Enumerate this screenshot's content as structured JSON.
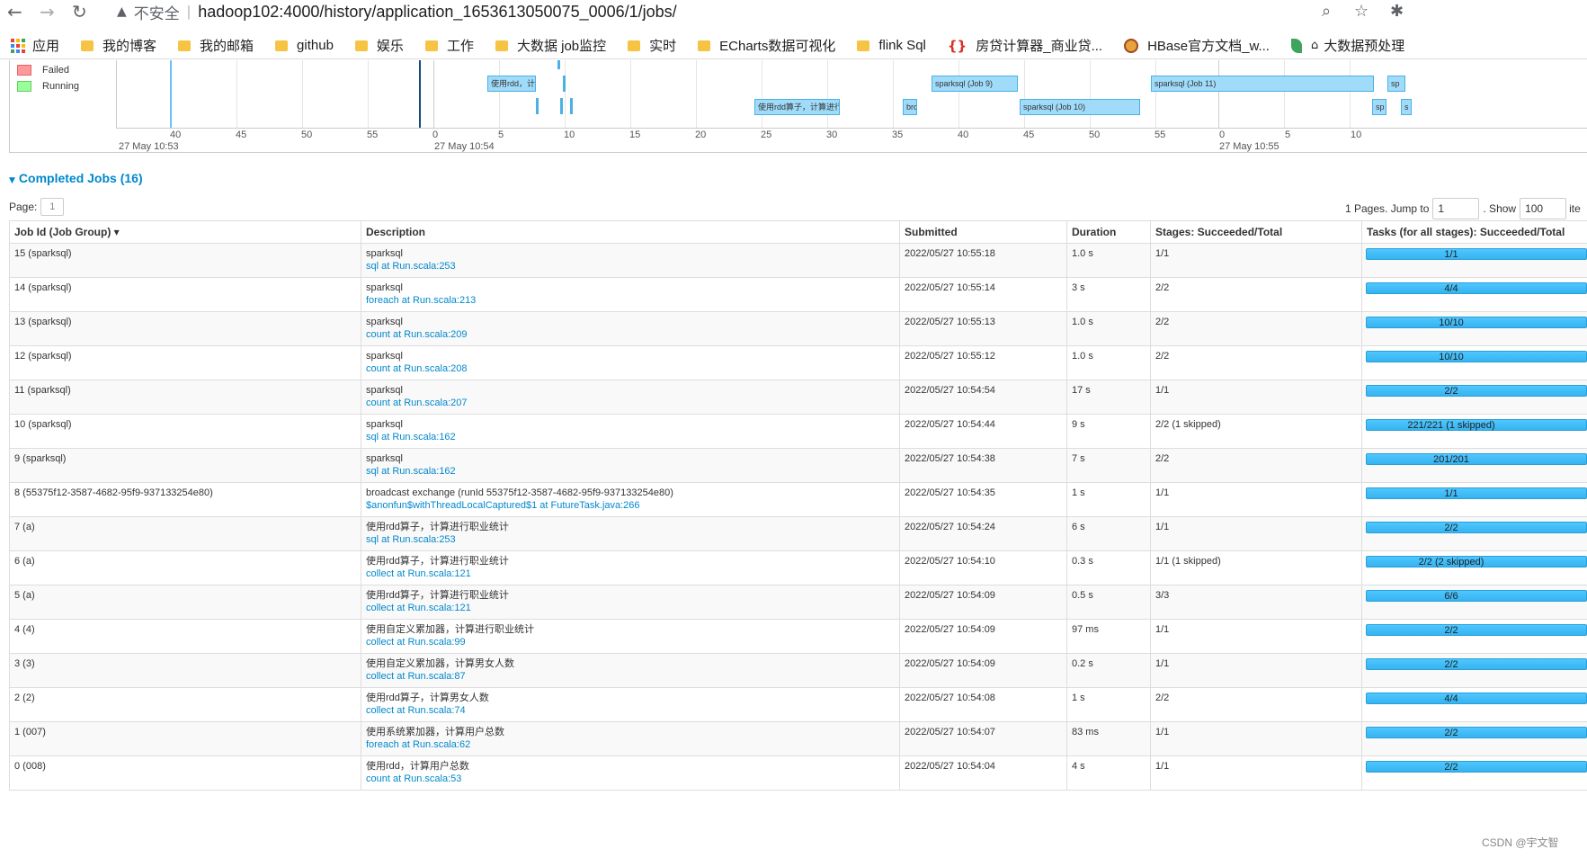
{
  "browser": {
    "insecure_label": "不安全",
    "url": "hadoop102:4000/history/application_1653613050075_0006/1/jobs/",
    "bookmarks": [
      "应用",
      "我的博客",
      "我的邮箱",
      "github",
      "娱乐",
      "工作",
      "大数据 job监控",
      "实时",
      "ECharts数据可视化",
      "flink Sql",
      "房贷计算器_商业贷...",
      "HBase官方文档_w...",
      "大数据预处理"
    ]
  },
  "timeline": {
    "legend": [
      {
        "label": "Failed",
        "color": "#ff9999"
      },
      {
        "label": "Running",
        "color": "#99ff99"
      }
    ],
    "ticks": [
      "40",
      "45",
      "50",
      "55",
      "0",
      "5",
      "10",
      "15",
      "20",
      "25",
      "30",
      "35",
      "40",
      "45",
      "50",
      "55",
      "0",
      "5",
      "10"
    ],
    "date_labels": [
      "27 May 10:53",
      "27 May 10:54",
      "27 May 10:55"
    ],
    "jobs": [
      {
        "label": "使用rdd，计"
      },
      {
        "label": "使用rdd算子，计算进行"
      },
      {
        "label": "sparksql (Job 9)"
      },
      {
        "label": "bro"
      },
      {
        "label": "sparksql (Job 10)"
      },
      {
        "label": "sparksql (Job 11)"
      },
      {
        "label": "sp"
      },
      {
        "label": "sp"
      },
      {
        "label": "s"
      }
    ]
  },
  "completed": {
    "title": "Completed Jobs (16)",
    "page_label": "Page:",
    "page_value": "1",
    "pages_text": "1 Pages. Jump to",
    "jump_value": "1",
    "show_text": ". Show",
    "show_value": "100",
    "items_text": "ite",
    "columns": [
      "Job Id (Job Group) ▾",
      "Description",
      "Submitted",
      "Duration",
      "Stages: Succeeded/Total",
      "Tasks (for all stages): Succeeded/Total"
    ],
    "rows": [
      {
        "id": "15 (sparksql)",
        "desc": "sparksql",
        "link": "sql at Run.scala:253",
        "submitted": "2022/05/27 10:55:18",
        "duration": "1.0 s",
        "stages": "1/1",
        "tasks": "1/1"
      },
      {
        "id": "14 (sparksql)",
        "desc": "sparksql",
        "link": "foreach at Run.scala:213",
        "submitted": "2022/05/27 10:55:14",
        "duration": "3 s",
        "stages": "2/2",
        "tasks": "4/4"
      },
      {
        "id": "13 (sparksql)",
        "desc": "sparksql",
        "link": "count at Run.scala:209",
        "submitted": "2022/05/27 10:55:13",
        "duration": "1.0 s",
        "stages": "2/2",
        "tasks": "10/10"
      },
      {
        "id": "12 (sparksql)",
        "desc": "sparksql",
        "link": "count at Run.scala:208",
        "submitted": "2022/05/27 10:55:12",
        "duration": "1.0 s",
        "stages": "2/2",
        "tasks": "10/10"
      },
      {
        "id": "11 (sparksql)",
        "desc": "sparksql",
        "link": "count at Run.scala:207",
        "submitted": "2022/05/27 10:54:54",
        "duration": "17 s",
        "stages": "1/1",
        "tasks": "2/2"
      },
      {
        "id": "10 (sparksql)",
        "desc": "sparksql",
        "link": "sql at Run.scala:162",
        "submitted": "2022/05/27 10:54:44",
        "duration": "9 s",
        "stages": "2/2 (1 skipped)",
        "tasks": "221/221 (1 skipped)"
      },
      {
        "id": "9 (sparksql)",
        "desc": "sparksql",
        "link": "sql at Run.scala:162",
        "submitted": "2022/05/27 10:54:38",
        "duration": "7 s",
        "stages": "2/2",
        "tasks": "201/201"
      },
      {
        "id": "8 (55375f12-3587-4682-95f9-937133254e80)",
        "desc": "broadcast exchange (runId 55375f12-3587-4682-95f9-937133254e80)",
        "link": "$anonfun$withThreadLocalCaptured$1 at FutureTask.java:266",
        "submitted": "2022/05/27 10:54:35",
        "duration": "1 s",
        "stages": "1/1",
        "tasks": "1/1"
      },
      {
        "id": "7 (a)",
        "desc": "使用rdd算子，计算进行职业统计",
        "link": "sql at Run.scala:253",
        "submitted": "2022/05/27 10:54:24",
        "duration": "6 s",
        "stages": "1/1",
        "tasks": "2/2"
      },
      {
        "id": "6 (a)",
        "desc": "使用rdd算子，计算进行职业统计",
        "link": "collect at Run.scala:121",
        "submitted": "2022/05/27 10:54:10",
        "duration": "0.3 s",
        "stages": "1/1 (1 skipped)",
        "tasks": "2/2 (2 skipped)"
      },
      {
        "id": "5 (a)",
        "desc": "使用rdd算子，计算进行职业统计",
        "link": "collect at Run.scala:121",
        "submitted": "2022/05/27 10:54:09",
        "duration": "0.5 s",
        "stages": "3/3",
        "tasks": "6/6"
      },
      {
        "id": "4 (4)",
        "desc": "使用自定义累加器，计算进行职业统计",
        "link": "collect at Run.scala:99",
        "submitted": "2022/05/27 10:54:09",
        "duration": "97 ms",
        "stages": "1/1",
        "tasks": "2/2"
      },
      {
        "id": "3 (3)",
        "desc": "使用自定义累加器，计算男女人数",
        "link": "collect at Run.scala:87",
        "submitted": "2022/05/27 10:54:09",
        "duration": "0.2 s",
        "stages": "1/1",
        "tasks": "2/2"
      },
      {
        "id": "2 (2)",
        "desc": "使用rdd算子，计算男女人数",
        "link": "collect at Run.scala:74",
        "submitted": "2022/05/27 10:54:08",
        "duration": "1 s",
        "stages": "2/2",
        "tasks": "4/4"
      },
      {
        "id": "1 (007)",
        "desc": "使用系统累加器，计算用户总数",
        "link": "foreach at Run.scala:62",
        "submitted": "2022/05/27 10:54:07",
        "duration": "83 ms",
        "stages": "1/1",
        "tasks": "2/2"
      },
      {
        "id": "0 (008)",
        "desc": "使用rdd，计算用户总数",
        "link": "count at Run.scala:53",
        "submitted": "2022/05/27 10:54:04",
        "duration": "4 s",
        "stages": "1/1",
        "tasks": "2/2"
      }
    ]
  },
  "watermark": "CSDN @宇文智"
}
